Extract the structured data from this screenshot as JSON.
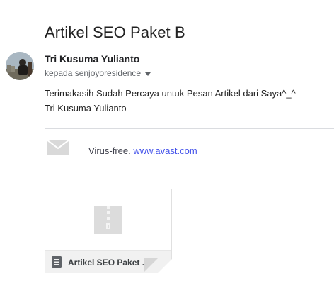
{
  "email": {
    "subject": "Artikel SEO Paket B",
    "sender": {
      "name": "Tri Kusuma Yulianto"
    },
    "recipient_line": "kepada senjoyoresidence",
    "body_lines": [
      "Terimakasih Sudah Percaya untuk Pesan Artikel dari Saya^_^",
      "Tri Kusuma Yulianto"
    ]
  },
  "signature": {
    "prefix": "Virus-free.",
    "link_text": "www.avast.com"
  },
  "attachment": {
    "name": "Artikel SEO Paket ..."
  },
  "icons": {
    "avatar": "user-photo",
    "recipient_menu": "caret-down-icon",
    "signature": "envelope-icon",
    "attachment_type": "document-icon",
    "attachment_preview": "zip-file-icon"
  },
  "colors": {
    "link": "#4453ea",
    "muted_text": "#5f6368",
    "divider": "#dadce0"
  }
}
